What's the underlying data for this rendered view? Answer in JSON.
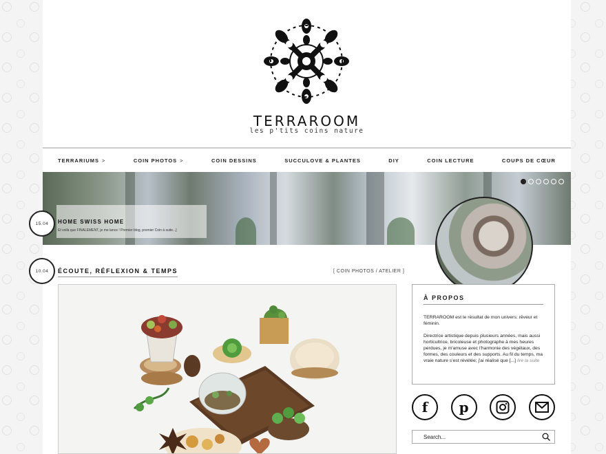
{
  "brand": {
    "name": "TERRAROOM",
    "tagline": "les p'tits coins nature"
  },
  "nav": {
    "items": [
      {
        "label": "Terrariums",
        "chevron": ">"
      },
      {
        "label": "Coin photos",
        "chevron": ">"
      },
      {
        "label": "Coin dessins",
        "chevron": ""
      },
      {
        "label": "Succulove & plantes",
        "chevron": ""
      },
      {
        "label": "DIY",
        "chevron": ""
      },
      {
        "label": "Coin lecture",
        "chevron": ""
      },
      {
        "label": "Coups de cœur",
        "chevron": ""
      }
    ]
  },
  "slider": {
    "date": "15.04",
    "title": "HOME SWISS HOME",
    "excerpt": "Et voilà que FINALEMENT, je me lance ! Premier blog, premier Coin à suite...]",
    "dots": 6,
    "active_dot": 0
  },
  "post": {
    "date": "10.04",
    "title": "ÉCOUTE, RÉFLEXION & TEMPS",
    "category": "[ COIN PHOTOS / ATELIER ]"
  },
  "about": {
    "title": "À PROPOS",
    "p1": "TERRAROOM est le résultat de mon univers: rêveur et féminin.",
    "p2": "Directrice artistique depuis plusieurs années, mais aussi horticultrice, bricoleuse et photographe à mes heures perdues, je m'amuse avec l'harmonie des végétaux, des formes, des couleurs et des supports. Au fil du temps, ma vraie nature s'est révélée; j'ai réalisé que [...]",
    "more": "lire la suite"
  },
  "socials": {
    "facebook": "f",
    "pinterest": "p",
    "instagram": "instagram-icon",
    "email": "email-icon"
  },
  "search": {
    "placeholder": "Search..."
  }
}
